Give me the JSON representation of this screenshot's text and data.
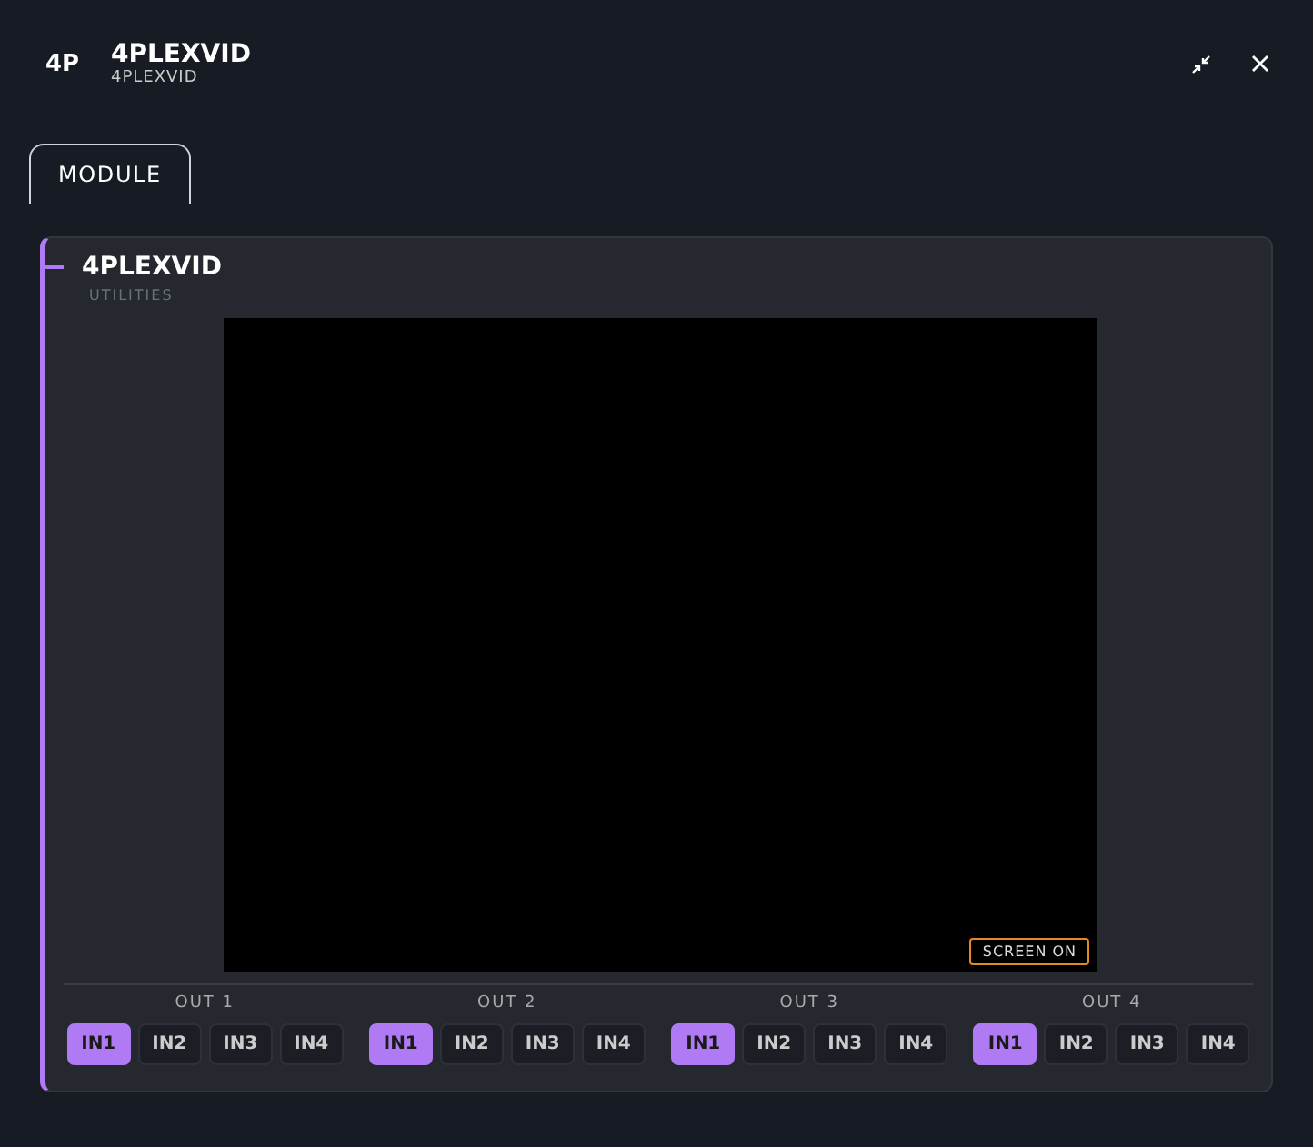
{
  "header": {
    "badge": "4P",
    "title": "4PLEXVID",
    "subtitle": "4PLEXVID"
  },
  "tabs": [
    {
      "label": "MODULE",
      "selected": true
    }
  ],
  "module": {
    "title": "4PLEXVID",
    "subtitle": "UTILITIES",
    "screen": {
      "status": "SCREEN ON"
    },
    "outputs": [
      {
        "label": "OUT 1",
        "inputs": [
          {
            "label": "IN1",
            "selected": true
          },
          {
            "label": "IN2",
            "selected": false
          },
          {
            "label": "IN3",
            "selected": false
          },
          {
            "label": "IN4",
            "selected": false
          }
        ]
      },
      {
        "label": "OUT 2",
        "inputs": [
          {
            "label": "IN1",
            "selected": true
          },
          {
            "label": "IN2",
            "selected": false
          },
          {
            "label": "IN3",
            "selected": false
          },
          {
            "label": "IN4",
            "selected": false
          }
        ]
      },
      {
        "label": "OUT 3",
        "inputs": [
          {
            "label": "IN1",
            "selected": true
          },
          {
            "label": "IN2",
            "selected": false
          },
          {
            "label": "IN3",
            "selected": false
          },
          {
            "label": "IN4",
            "selected": false
          }
        ]
      },
      {
        "label": "OUT 4",
        "inputs": [
          {
            "label": "IN1",
            "selected": true
          },
          {
            "label": "IN2",
            "selected": false
          },
          {
            "label": "IN3",
            "selected": false
          },
          {
            "label": "IN4",
            "selected": false
          }
        ]
      }
    ]
  }
}
